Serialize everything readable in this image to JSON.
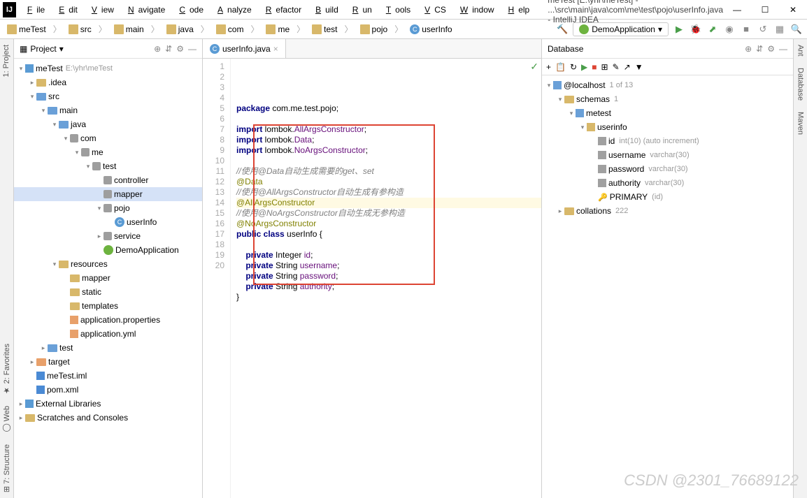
{
  "title": "meTest [E:\\yhr\\meTest] - ...\\src\\main\\java\\com\\me\\test\\pojo\\userInfo.java - IntelliJ IDEA",
  "menu": [
    "File",
    "Edit",
    "View",
    "Navigate",
    "Code",
    "Analyze",
    "Refactor",
    "Build",
    "Run",
    "Tools",
    "VCS",
    "Window",
    "Help"
  ],
  "breadcrumb": [
    "meTest",
    "src",
    "main",
    "java",
    "com",
    "me",
    "test",
    "pojo",
    "userInfo"
  ],
  "run_config": "DemoApplication",
  "project": {
    "title": "Project",
    "root": {
      "name": "meTest",
      "path": "E:\\yhr\\meTest"
    },
    "nodes": [
      {
        "d": 1,
        "arrow": ">",
        "icon": "fold",
        "label": ".idea"
      },
      {
        "d": 1,
        "arrow": "v",
        "icon": "fold-blue",
        "label": "src"
      },
      {
        "d": 2,
        "arrow": "v",
        "icon": "fold-blue",
        "label": "main"
      },
      {
        "d": 3,
        "arrow": "v",
        "icon": "fold-blue",
        "label": "java"
      },
      {
        "d": 4,
        "arrow": "v",
        "icon": "pkg",
        "label": "com"
      },
      {
        "d": 5,
        "arrow": "v",
        "icon": "pkg",
        "label": "me"
      },
      {
        "d": 6,
        "arrow": "v",
        "icon": "pkg",
        "label": "test"
      },
      {
        "d": 7,
        "arrow": " ",
        "icon": "pkg",
        "label": "controller"
      },
      {
        "d": 7,
        "arrow": " ",
        "icon": "pkg",
        "label": "mapper",
        "sel": true
      },
      {
        "d": 7,
        "arrow": "v",
        "icon": "pkg",
        "label": "pojo"
      },
      {
        "d": 8,
        "arrow": " ",
        "icon": "class",
        "label": "userInfo"
      },
      {
        "d": 7,
        "arrow": ">",
        "icon": "pkg",
        "label": "service"
      },
      {
        "d": 7,
        "arrow": " ",
        "icon": "spring",
        "label": "DemoApplication"
      },
      {
        "d": 3,
        "arrow": "v",
        "icon": "fold",
        "label": "resources"
      },
      {
        "d": 4,
        "arrow": " ",
        "icon": "fold",
        "label": "mapper"
      },
      {
        "d": 4,
        "arrow": " ",
        "icon": "fold",
        "label": "static"
      },
      {
        "d": 4,
        "arrow": " ",
        "icon": "fold",
        "label": "templates"
      },
      {
        "d": 4,
        "arrow": " ",
        "icon": "yml",
        "label": "application.properties"
      },
      {
        "d": 4,
        "arrow": " ",
        "icon": "yml",
        "label": "application.yml"
      },
      {
        "d": 2,
        "arrow": ">",
        "icon": "fold-blue",
        "label": "test"
      },
      {
        "d": 1,
        "arrow": ">",
        "icon": "fold-orange",
        "label": "target"
      },
      {
        "d": 1,
        "arrow": " ",
        "icon": "xml",
        "label": "meTest.iml"
      },
      {
        "d": 1,
        "arrow": " ",
        "icon": "xml",
        "label": "pom.xml"
      }
    ],
    "external": "External Libraries",
    "scratches": "Scratches and Consoles"
  },
  "editor": {
    "tab": "userInfo.java",
    "lines": [
      {
        "n": 1,
        "tokens": [
          {
            "t": "package ",
            "c": "kw"
          },
          {
            "t": "com.me.test.pojo;"
          }
        ]
      },
      {
        "n": 2,
        "tokens": []
      },
      {
        "n": 3,
        "tokens": [
          {
            "t": "import ",
            "c": "kw"
          },
          {
            "t": "lombok."
          },
          {
            "t": "AllArgsConstructor",
            "c": "str"
          },
          {
            "t": ";"
          }
        ]
      },
      {
        "n": 4,
        "tokens": [
          {
            "t": "import ",
            "c": "kw"
          },
          {
            "t": "lombok."
          },
          {
            "t": "Data",
            "c": "str"
          },
          {
            "t": ";"
          }
        ]
      },
      {
        "n": 5,
        "tokens": [
          {
            "t": "import ",
            "c": "kw"
          },
          {
            "t": "lombok."
          },
          {
            "t": "NoArgsConstructor",
            "c": "str"
          },
          {
            "t": ";"
          }
        ]
      },
      {
        "n": 6,
        "tokens": []
      },
      {
        "n": 7,
        "tokens": [
          {
            "t": "//使用@Data自动生成需要的get、set",
            "c": "comment"
          }
        ]
      },
      {
        "n": 8,
        "tokens": [
          {
            "t": "@Data",
            "c": "ann"
          }
        ]
      },
      {
        "n": 9,
        "tokens": [
          {
            "t": "//使用@AllArgsConstructor自动生成有参构造",
            "c": "comment"
          }
        ]
      },
      {
        "n": 10,
        "hl": true,
        "tokens": [
          {
            "t": "@AllArgsConstructor",
            "c": "ann"
          }
        ]
      },
      {
        "n": 11,
        "tokens": [
          {
            "t": "//使用@NoArgsConstructor自动生成无参构造",
            "c": "comment"
          }
        ]
      },
      {
        "n": 12,
        "tokens": [
          {
            "t": "@NoArgsConstructor",
            "c": "ann"
          }
        ]
      },
      {
        "n": 13,
        "tokens": [
          {
            "t": "public class ",
            "c": "kw"
          },
          {
            "t": "userInfo {"
          }
        ]
      },
      {
        "n": 14,
        "tokens": []
      },
      {
        "n": 15,
        "tokens": [
          {
            "t": "    "
          },
          {
            "t": "private ",
            "c": "kw"
          },
          {
            "t": "Integer "
          },
          {
            "t": "id",
            "c": "str"
          },
          {
            "t": ";"
          }
        ]
      },
      {
        "n": 16,
        "tokens": [
          {
            "t": "    "
          },
          {
            "t": "private ",
            "c": "kw"
          },
          {
            "t": "String "
          },
          {
            "t": "username",
            "c": "str"
          },
          {
            "t": ";"
          }
        ]
      },
      {
        "n": 17,
        "tokens": [
          {
            "t": "    "
          },
          {
            "t": "private ",
            "c": "kw"
          },
          {
            "t": "String "
          },
          {
            "t": "password",
            "c": "str"
          },
          {
            "t": ";"
          }
        ]
      },
      {
        "n": 18,
        "tokens": [
          {
            "t": "    "
          },
          {
            "t": "private ",
            "c": "kw"
          },
          {
            "t": "String "
          },
          {
            "t": "authority",
            "c": "str"
          },
          {
            "t": ";"
          }
        ]
      },
      {
        "n": 19,
        "tokens": [
          {
            "t": "}"
          }
        ]
      },
      {
        "n": 20,
        "tokens": []
      }
    ]
  },
  "database": {
    "title": "Database",
    "host": "@localhost",
    "host_count": "1 of 13",
    "schemas": {
      "label": "schemas",
      "count": "1"
    },
    "db": "metest",
    "table": "userinfo",
    "columns": [
      {
        "name": "id",
        "type": "int(10) (auto increment)",
        "icon": "col"
      },
      {
        "name": "username",
        "type": "varchar(30)",
        "icon": "col"
      },
      {
        "name": "password",
        "type": "varchar(30)",
        "icon": "col"
      },
      {
        "name": "authority",
        "type": "varchar(30)",
        "icon": "col"
      },
      {
        "name": "PRIMARY",
        "type": "(id)",
        "icon": "key"
      }
    ],
    "collations": {
      "label": "collations",
      "count": "222"
    }
  },
  "right_tabs": [
    "Ant",
    "Database",
    "Maven"
  ],
  "watermark": "CSDN @2301_76689122"
}
